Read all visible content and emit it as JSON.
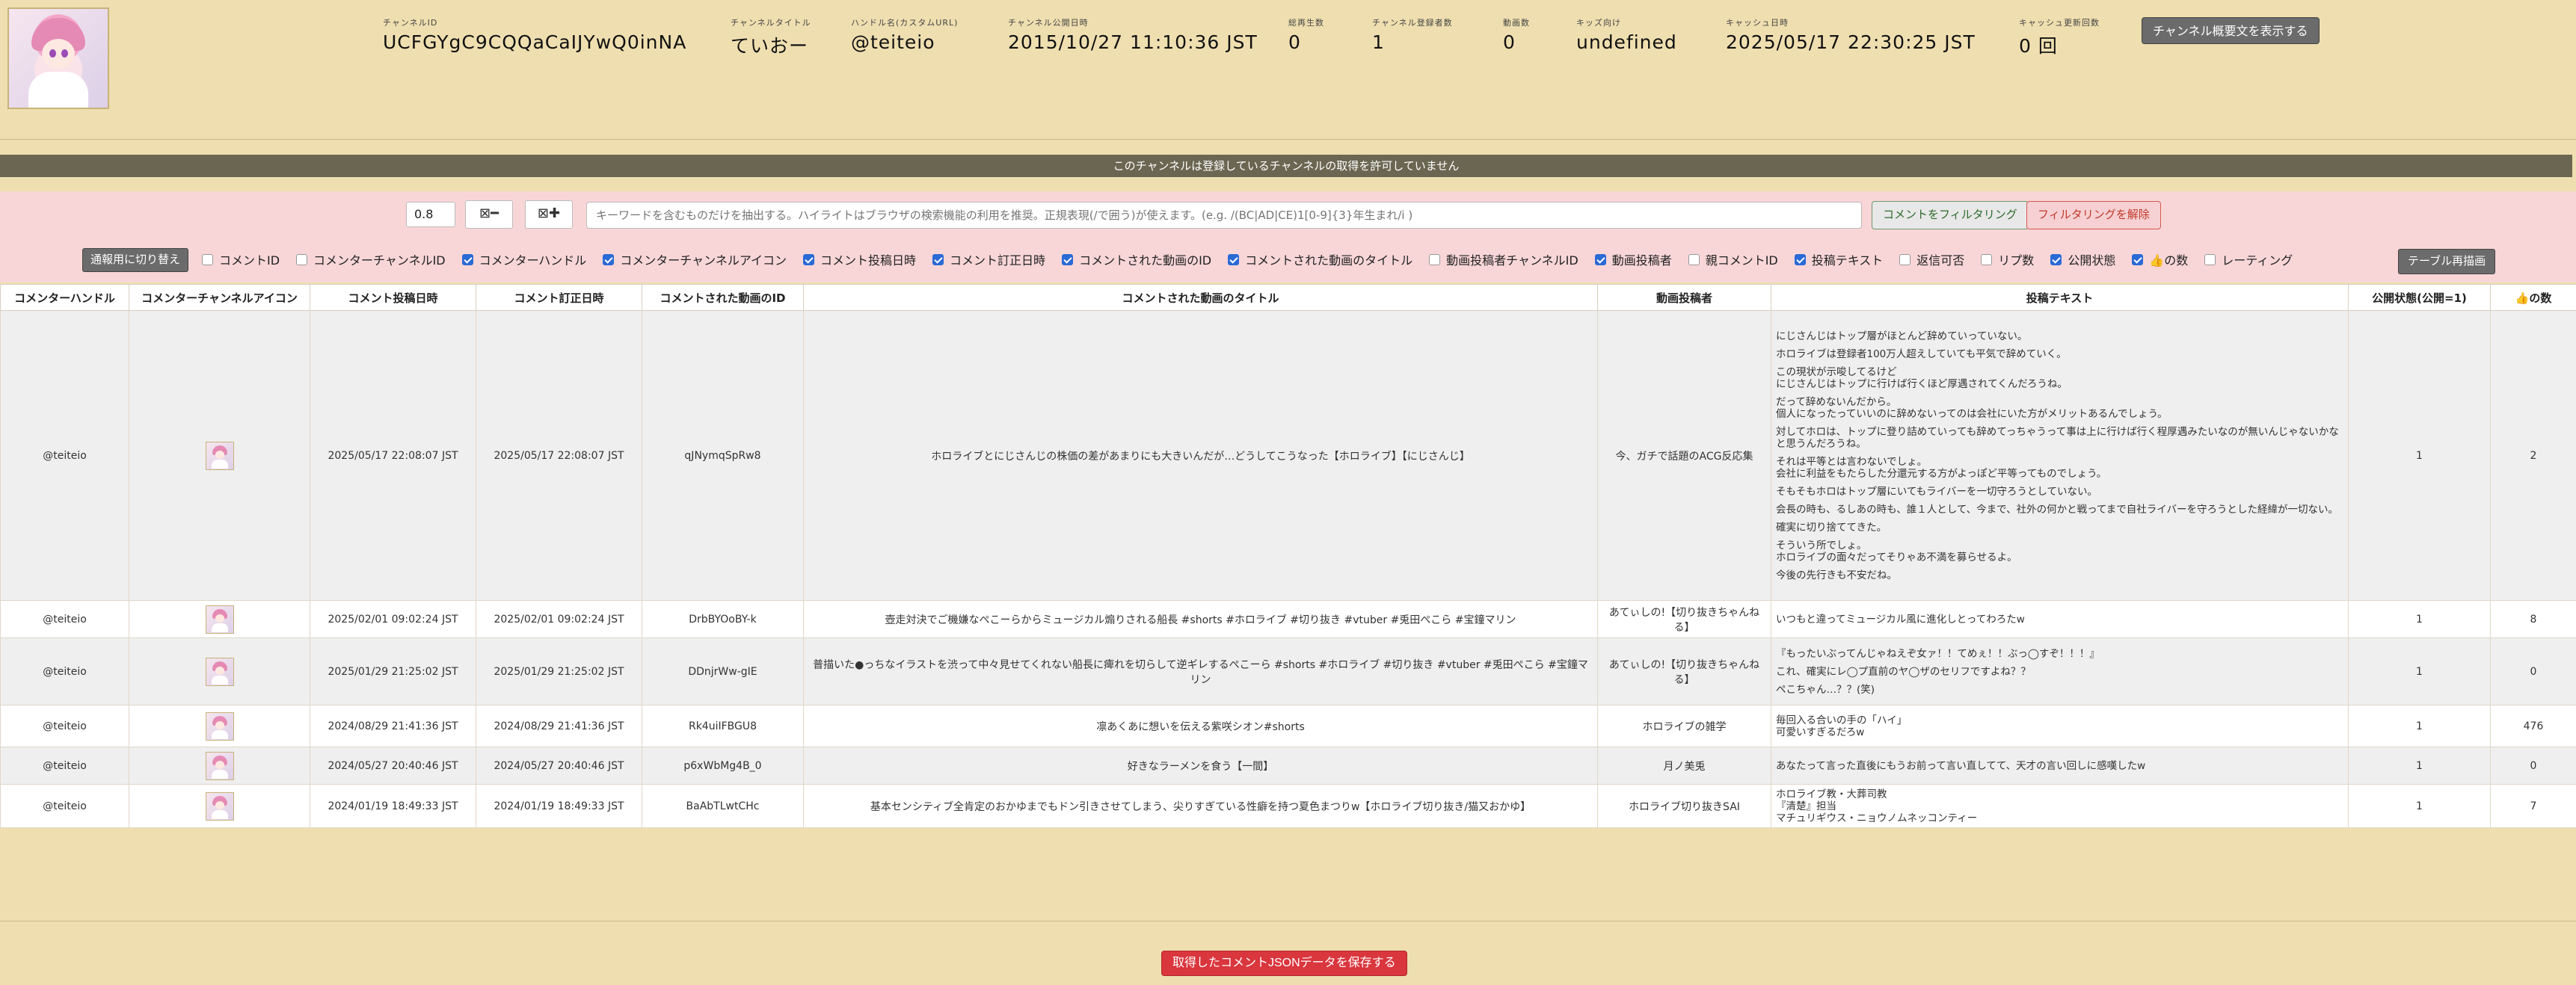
{
  "channel": {
    "id_label": "チャンネルID",
    "id": "UCFGYgC9CQQaCaIJYwQ0inNA",
    "title_label": "チャンネルタイトル",
    "title": "ていおー",
    "handle_label": "ハンドル名(カスタムURL)",
    "handle": "@teiteio",
    "published_label": "チャンネル公開日時",
    "published": "2015/10/27 11:10:36 JST",
    "views_label": "総再生数",
    "views": "0",
    "subscribers_label": "チャンネル登録者数",
    "subscribers": "1",
    "videos_label": "動画数",
    "videos": "0",
    "kids_label": "キッズ向け",
    "kids": "undefined",
    "cache_date_label": "キャッシュ日時",
    "cache_date": "2025/05/17 22:30:25 JST",
    "cache_count_label": "キャッシュ更新回数",
    "cache_count": "0 回",
    "show_description_button": "チャンネル概要文を表示する"
  },
  "banner": "このチャンネルは登録しているチャンネルの取得を許可していません",
  "controls": {
    "zoom_value": "0.8",
    "zoom_out_glyph": "⊠━",
    "zoom_in_glyph": "⊠✚",
    "filter_placeholder": "キーワードを含むものだけを抽出する。ハイライトはブラウザの検索機能の利用を推奨。正規表現(/で囲う)が使えます。(e.g. /(BC|AD|CE)1[0-9]{3}年生まれ/i )",
    "filter_button": "コメントをフィルタリング",
    "clear_button": "フィルタリングを解除",
    "mode_button": "通報用に切り替え",
    "redraw_button": "テーブル再描画",
    "columns": [
      {
        "label": "コメントID",
        "checked": false
      },
      {
        "label": "コメンターチャンネルID",
        "checked": false
      },
      {
        "label": "コメンターハンドル",
        "checked": true
      },
      {
        "label": "コメンターチャンネルアイコン",
        "checked": true
      },
      {
        "label": "コメント投稿日時",
        "checked": true
      },
      {
        "label": "コメント訂正日時",
        "checked": true
      },
      {
        "label": "コメントされた動画のID",
        "checked": true
      },
      {
        "label": "コメントされた動画のタイトル",
        "checked": true
      },
      {
        "label": "動画投稿者チャンネルID",
        "checked": false
      },
      {
        "label": "動画投稿者",
        "checked": true
      },
      {
        "label": "親コメントID",
        "checked": false
      },
      {
        "label": "投稿テキスト",
        "checked": true
      },
      {
        "label": "返信可否",
        "checked": false
      },
      {
        "label": "リプ数",
        "checked": false
      },
      {
        "label": "公開状態",
        "checked": true
      },
      {
        "label": "👍の数",
        "checked": true
      },
      {
        "label": "レーティング",
        "checked": false
      }
    ]
  },
  "table": {
    "headers": [
      "コメンターハンドル",
      "コメンターチャンネルアイコン",
      "コメント投稿日時",
      "コメント訂正日時",
      "コメントされた動画のID",
      "コメントされた動画のタイトル",
      "動画投稿者",
      "投稿テキスト",
      "公開状態(公開=1)",
      "👍の数"
    ],
    "rows": [
      {
        "handle": "@teiteio",
        "posted": "2025/05/17 22:08:07 JST",
        "edited": "2025/05/17 22:08:07 JST",
        "video_id": "qJNymqSpRw8",
        "video_title": "ホロライブとにじさんじの株価の差があまりにも大きいんだが…どうしてこうなった【ホロライブ】【にじさんじ】",
        "uploader": "今、ガチで話題のACG反応集",
        "text": [
          "にじさんじはトップ層がほとんど辞めていっていない。",
          "ホロライブは登録者100万人超えしていても平気で辞めていく。",
          "この現状が示唆してるけど\nにじさんじはトップに行けば行くほど厚遇されてくんだろうね。",
          "だって辞めないんだから。\n個人になったっていいのに辞めないってのは会社にいた方がメリットあるんでしょう。",
          "対してホロは、トップに登り詰めていっても辞めてっちゃうって事は上に行けば行く程厚遇みたいなのが無いんじゃないかなと思うんだろうね。",
          "それは平等とは言わないでしょ。\n会社に利益をもたらした分還元する方がよっぽど平等ってものでしょう。",
          "そもそもホロはトップ層にいてもライバーを一切守ろうとしていない。",
          "会長の時も、るしあの時も、誰１人として、今まで、社外の何かと戦ってまで自社ライバーを守ろうとした経緯が一切ない。",
          "確実に切り捨ててきた。",
          "そういう所でしょ。\nホロライブの面々だってそりゃあ不満を募らせるよ。",
          "今後の先行きも不安だね。"
        ],
        "status": "1",
        "likes": "2"
      },
      {
        "handle": "@teiteio",
        "posted": "2025/02/01 09:02:24 JST",
        "edited": "2025/02/01 09:02:24 JST",
        "video_id": "DrbBYOoBY-k",
        "video_title": "壺走対決でご機嫌なぺこーらからミュージカル煽りされる船長 #shorts #ホロライブ #切り抜き #vtuber #兎田ぺこら #宝鐘マリン",
        "uploader": "あてぃしの!【切り抜きちゃんねる】",
        "text": [
          "いつもと違ってミュージカル風に進化しとってわろたw"
        ],
        "status": "1",
        "likes": "8"
      },
      {
        "handle": "@teiteio",
        "posted": "2025/01/29 21:25:02 JST",
        "edited": "2025/01/29 21:25:02 JST",
        "video_id": "DDnjrWw-gIE",
        "video_title": "普描いた●っちなイラストを渋って中々見せてくれない船長に痺れを切らして逆ギレするぺこーら #shorts #ホロライブ #切り抜き #vtuber #兎田ぺこら #宝鐘マリン",
        "uploader": "あてぃしの!【切り抜きちゃんねる】",
        "text": [
          "『もったいぶってんじゃねえぞ女ァ！！てめぇ！！ぶっ◯すぞ！！！』",
          "これ、確実にレ◯プ直前のヤ◯ザのセリフですよね？？",
          "ぺこちゃん…？？(笑)"
        ],
        "status": "1",
        "likes": "0"
      },
      {
        "handle": "@teiteio",
        "posted": "2024/08/29 21:41:36 JST",
        "edited": "2024/08/29 21:41:36 JST",
        "video_id": "Rk4uiIFBGU8",
        "video_title": "凛あくあに想いを伝える紫咲シオン#shorts",
        "uploader": "ホロライブの雑学",
        "text": [
          "毎回入る合いの手の「ハイ」\n可愛いすぎるだろw"
        ],
        "status": "1",
        "likes": "476"
      },
      {
        "handle": "@teiteio",
        "posted": "2024/05/27 20:40:46 JST",
        "edited": "2024/05/27 20:40:46 JST",
        "video_id": "p6xWbMg4B_0",
        "video_title": "好きなラーメンを食う【一間】",
        "uploader": "月ノ美兎",
        "text": [
          "あなたって言った直後にもうお前って言い直してて、天才の言い回しに感嘆したw"
        ],
        "status": "1",
        "likes": "0"
      },
      {
        "handle": "@teiteio",
        "posted": "2024/01/19 18:49:33 JST",
        "edited": "2024/01/19 18:49:33 JST",
        "video_id": "BaAbTLwtCHc",
        "video_title": "基本センシティブ全肯定のおかゆまでもドン引きさせてしまう、尖りすぎている性癖を持つ夏色まつりw【ホロライブ切り抜き/猫又おかゆ】",
        "uploader": "ホロライブ切り抜きSAI",
        "text": [
          "ホロライブ教・大葬司教\n『清楚』担当\nマチュリギウス・ニョウノムネッコンティー"
        ],
        "status": "1",
        "likes": "7"
      }
    ]
  },
  "save_button": "取得したコメントJSONデータを保存する"
}
